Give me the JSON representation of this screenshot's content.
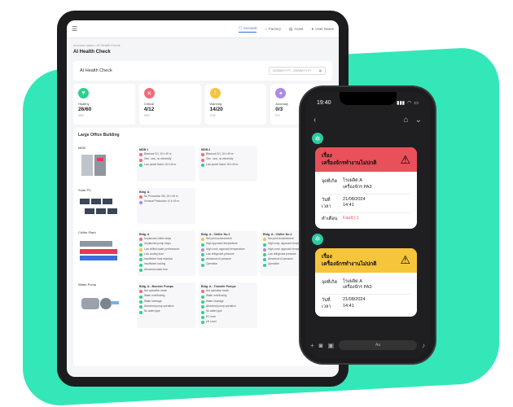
{
  "tablet": {
    "nav": {
      "items": [
        {
          "icon": "account-icon",
          "label": "Account",
          "active": true
        },
        {
          "icon": "factory-icon",
          "label": "Factory",
          "active": false
        },
        {
          "icon": "asset-icon",
          "label": "Asset",
          "active": false
        },
        {
          "icon": "user-icon",
          "label": "User Name",
          "active": false
        }
      ]
    },
    "breadcrumb": "Account name  /  AI Health Check",
    "page_title": "AI Health Check",
    "panel_title": "AI Health Check",
    "date_placeholder": "DD/MM/YYYY  -  DD/MM/YYYY",
    "kpis": [
      {
        "label": "Healthy",
        "value": "26/60",
        "pct": "45%",
        "color": "#2fcf8f",
        "icon": "heart-icon"
      },
      {
        "label": "Critical",
        "value": "4/12",
        "pct": "30%",
        "color": "#ef6c7a",
        "icon": "x-icon"
      },
      {
        "label": "Warning",
        "value": "14/20",
        "pct": "70%",
        "color": "#f4c542",
        "icon": "exclamation-icon"
      },
      {
        "label": "Anomaly",
        "value": "0/3",
        "pct": "0%",
        "color": "#a98be8",
        "icon": "anomaly-icon"
      }
    ],
    "building_title": "Large Office Building",
    "systems": [
      {
        "name": "MDB",
        "cards": [
          {
            "title": "MDB 1",
            "alarms": [
              {
                "c": "red",
                "t": "Blackout        02 | 10 h 49 m"
              },
              {
                "c": "red",
                "t": "Gen. runs, no electricity"
              },
              {
                "c": "green",
                "t": "Low power factor    18 h 49 m"
              }
            ]
          },
          {
            "title": "MDB 2",
            "alarms": [
              {
                "c": "red",
                "t": "Blackout        02 | 10 h 49 m"
              },
              {
                "c": "red",
                "t": "Gen. runs, no electricity"
              },
              {
                "c": "green",
                "t": "Low power factor    18 h 49 m"
              }
            ]
          }
        ]
      },
      {
        "name": "Solar PV",
        "cards": [
          {
            "title": "Bldg. A",
            "alarms": [
              {
                "c": "red",
                "t": "No Production    08 | 10 h 49 m"
              },
              {
                "c": "purple",
                "t": "Unusual Production    10 h 49 m"
              }
            ]
          }
        ]
      },
      {
        "name": "Chiller Plant",
        "cards": [
          {
            "title": "Bldg. A",
            "alarms": [
              {
                "c": "red",
                "t": "Unplanned chiller stops"
              },
              {
                "c": "green",
                "t": "Unplanned pump stops"
              },
              {
                "c": "yellow",
                "t": "Low chilled water performance"
              },
              {
                "c": "green",
                "t": "Low cooling load"
              },
              {
                "c": "green",
                "t": "Insufficient heat rejection"
              },
              {
                "c": "green",
                "t": "Insufficient cooling"
              },
              {
                "c": "green",
                "t": "Abnormal water flow"
              }
            ]
          },
          {
            "title": "Bldg. A - Chiller No.1",
            "alarms": [
              {
                "c": "yellow",
                "t": "Set point achievement"
              },
              {
                "c": "green",
                "t": "High approach temperature"
              },
              {
                "c": "purple",
                "t": "High cond. approach temperature"
              },
              {
                "c": "green",
                "t": "Low refrigerant pressure"
              },
              {
                "c": "green",
                "t": "Abnormal oil pressure"
              },
              {
                "c": "green",
                "t": "Operation"
              }
            ]
          },
          {
            "title": "Bldg. A - Chiller No.2",
            "alarms": [
              {
                "c": "yellow",
                "t": "Set point achievement"
              },
              {
                "c": "green",
                "t": "High evap. approach temperature"
              },
              {
                "c": "purple",
                "t": "High cond. approach temperature"
              },
              {
                "c": "green",
                "t": "Low refrigerant pressure"
              },
              {
                "c": "green",
                "t": "Abnormal oil pressure"
              },
              {
                "c": "green",
                "t": "Operation"
              }
            ]
          }
        ]
      },
      {
        "name": "Water Pump",
        "cards": [
          {
            "title": "Bldg. A - Booster Pumps",
            "alarms": [
              {
                "c": "red",
                "t": "Not operation mode"
              },
              {
                "c": "green",
                "t": "Water overflowing"
              },
              {
                "c": "green",
                "t": "Water shortage"
              },
              {
                "c": "green",
                "t": "Abnormal pump operation"
              },
              {
                "c": "green",
                "t": "No water pipe"
              }
            ]
          },
          {
            "title": "Bldg. A - Transfer Pumps",
            "alarms": [
              {
                "c": "red",
                "t": "Not operation mode"
              },
              {
                "c": "green",
                "t": "Water overflowing"
              },
              {
                "c": "green",
                "t": "Water shortage"
              },
              {
                "c": "green",
                "t": "Abnormal pump operation"
              },
              {
                "c": "green",
                "t": "No water pipe"
              },
              {
                "c": "green",
                "t": "EC level"
              },
              {
                "c": "green",
                "t": "pH Level"
              }
            ]
          }
        ]
      }
    ]
  },
  "phone": {
    "time": "19:40",
    "messages": [
      {
        "color": "red",
        "title": "เรื่อง",
        "subtitle": "เครื่องจักรทำงานไม่ปกติ",
        "rows": [
          {
            "k": "จุดที่เกิด",
            "v": "โรงผลิต A\nเครื่องจักร PA3"
          },
          {
            "k": "วันที่\nเวลา",
            "v": "21/08/2024\n14:41"
          },
          {
            "k": "คำเตือน",
            "v": "Fault  |  1",
            "fault": true
          }
        ]
      },
      {
        "color": "yellow",
        "title": "เรื่อง",
        "subtitle": "เครื่องจักรทำงานไม่ปกติ",
        "rows": [
          {
            "k": "จุดที่เกิด",
            "v": "โรงผลิต A\nเครื่องจักร PA3"
          },
          {
            "k": "วันที่\nเวลา",
            "v": "21/08/2024\n14:41"
          }
        ]
      }
    ],
    "input_placeholder": "Aa"
  }
}
